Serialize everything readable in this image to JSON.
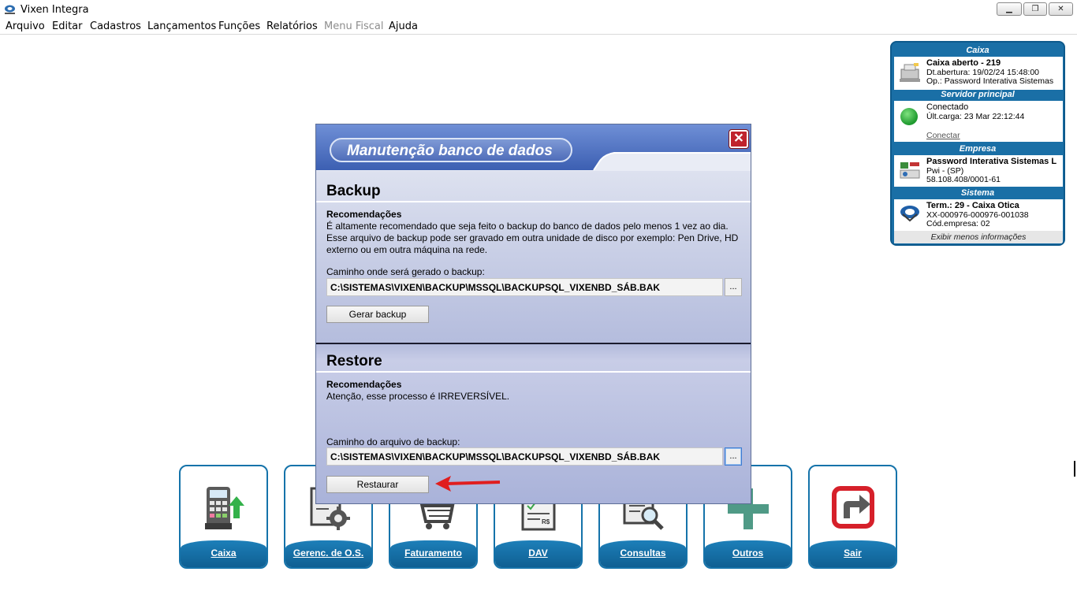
{
  "window": {
    "title": "Vixen Integra",
    "minimize_glyph": "▁",
    "restore_glyph": "❐",
    "close_glyph": "✕"
  },
  "menu": {
    "items": [
      {
        "label": "Arquivo"
      },
      {
        "label": "Editar"
      },
      {
        "label": "Cadastros"
      },
      {
        "label": "Lançamentos"
      },
      {
        "label": "Funções"
      },
      {
        "label": "Relatórios"
      },
      {
        "label": "Menu Fiscal",
        "disabled": true
      },
      {
        "label": "Ajuda"
      }
    ]
  },
  "info_panel": {
    "caixa": {
      "header": "Caixa",
      "line1": "Caixa aberto - 219",
      "line2": "Dt.abertura: 19/02/24 15:48:00",
      "line3": "Op.: Password Interativa Sistemas"
    },
    "servidor": {
      "header": "Servidor principal",
      "line1": "Conectado",
      "line2": "Últ.carga: 23 Mar 22:12:44",
      "link": "Conectar"
    },
    "empresa": {
      "header": "Empresa",
      "line1": "Password Interativa Sistemas L",
      "line2": "Pwi - (SP)",
      "line3": "58.108.408/0001-61"
    },
    "sistema": {
      "header": "Sistema",
      "line1": "Term.: 29 - Caixa Otica",
      "line2": "XX-000976-000976-001038",
      "line3": "Cód.empresa: 02"
    },
    "footer": "Exibir menos informações"
  },
  "tiles": [
    {
      "label": "Caixa",
      "icon": "cash-register-icon"
    },
    {
      "label": "Gerenc. de O.S.",
      "icon": "service-order-gear-icon"
    },
    {
      "label": "Faturamento",
      "icon": "shopping-cart-icon"
    },
    {
      "label": "DAV",
      "icon": "invoice-icon"
    },
    {
      "label": "Consultas",
      "icon": "search-document-icon"
    },
    {
      "label": "Outros",
      "icon": "plus-icon"
    },
    {
      "label": "Sair",
      "icon": "exit-icon"
    }
  ],
  "dialog": {
    "title": "Manutenção banco de dados",
    "close_glyph": "✕",
    "backup": {
      "title": "Backup",
      "rec_head": "Recomendações",
      "rec_body": "É altamente recomendado que seja feito o backup do banco de dados pelo menos 1 vez ao dia. Esse arquivo de backup pode ser gravado em outra unidade de disco por exemplo: Pen Drive, HD externo ou em outra máquina na rede.",
      "path_label": "Caminho onde será gerado o backup:",
      "path_value": "C:\\SISTEMAS\\VIXEN\\BACKUP\\MSSQL\\BACKUPSQL_VIXENBD_SÁB.BAK",
      "browse_label": "...",
      "button_label": "Gerar backup"
    },
    "restore": {
      "title": "Restore",
      "rec_head": "Recomendações",
      "rec_body": "Atenção, esse processo é IRREVERSÍVEL.",
      "path_label": "Caminho do arquivo de backup:",
      "path_value": "C:\\SISTEMAS\\VIXEN\\BACKUP\\MSSQL\\BACKUPSQL_VIXENBD_SÁB.BAK",
      "browse_label": "...",
      "button_label": "Restaurar"
    }
  },
  "colors": {
    "panel_blue": "#1a6fa6",
    "tile_blue": "#1573aa",
    "close_red": "#c0232c",
    "annotation_arrow": "#e01e1e"
  }
}
